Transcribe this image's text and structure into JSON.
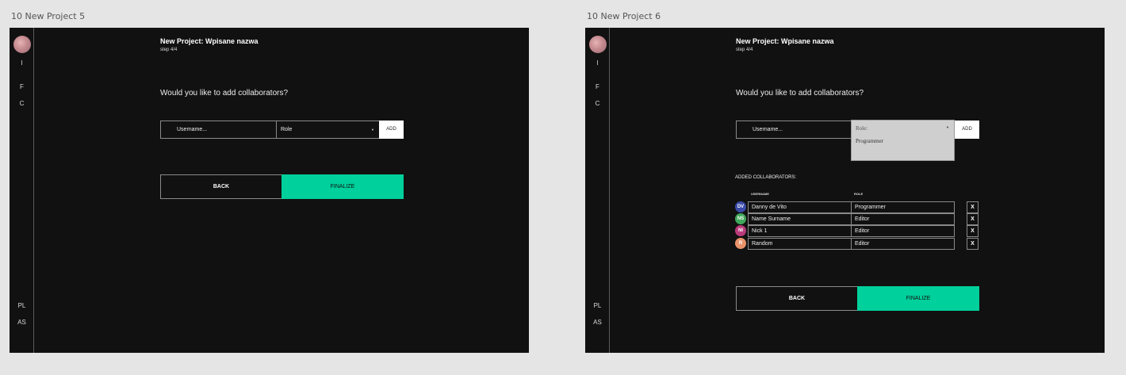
{
  "frames": [
    {
      "label": "10 New Project 5",
      "sidebar": {
        "top_letters": [
          "I",
          "F",
          "C"
        ],
        "bottom_letters": [
          "PL",
          "AS"
        ]
      },
      "title": "New Project: Wpisane nazwa",
      "step": "step 4/4",
      "question": "Would you like to add collaborators?",
      "username_placeholder": "Username...",
      "role_label": "Role",
      "add_label": "ADD",
      "back_label": "BACK",
      "finalize_label": "FINALIZE"
    },
    {
      "label": "10 New Project 6",
      "sidebar": {
        "top_letters": [
          "I",
          "F",
          "C"
        ],
        "bottom_letters": [
          "PL",
          "AS"
        ]
      },
      "title": "New Project: Wpisane nazwa",
      "step": "step 4/4",
      "question": "Would you like to add collaborators?",
      "username_placeholder": "Username...",
      "dropdown": {
        "label": "Role:",
        "options": [
          "Programmer"
        ]
      },
      "add_label": "ADD",
      "added_title": "ADDED COLLABORATORS:",
      "columns": {
        "username": "USERNAME",
        "role": "ROLE"
      },
      "collaborators": [
        {
          "initials": "DV",
          "name": "Danny de Vito",
          "role": "Programmer",
          "color": "#3a4aa8",
          "remove": "X"
        },
        {
          "initials": "NS",
          "name": "Name Surname",
          "role": "Editor",
          "color": "#3fa85a",
          "remove": "X"
        },
        {
          "initials": "NI",
          "name": "Nick 1",
          "role": "Editor",
          "color": "#b83a7a",
          "remove": "X"
        },
        {
          "initials": "R",
          "name": "Random",
          "role": "Editor",
          "color": "#e8936a",
          "remove": "X"
        }
      ],
      "back_label": "BACK",
      "finalize_label": "FINALIZE"
    }
  ]
}
